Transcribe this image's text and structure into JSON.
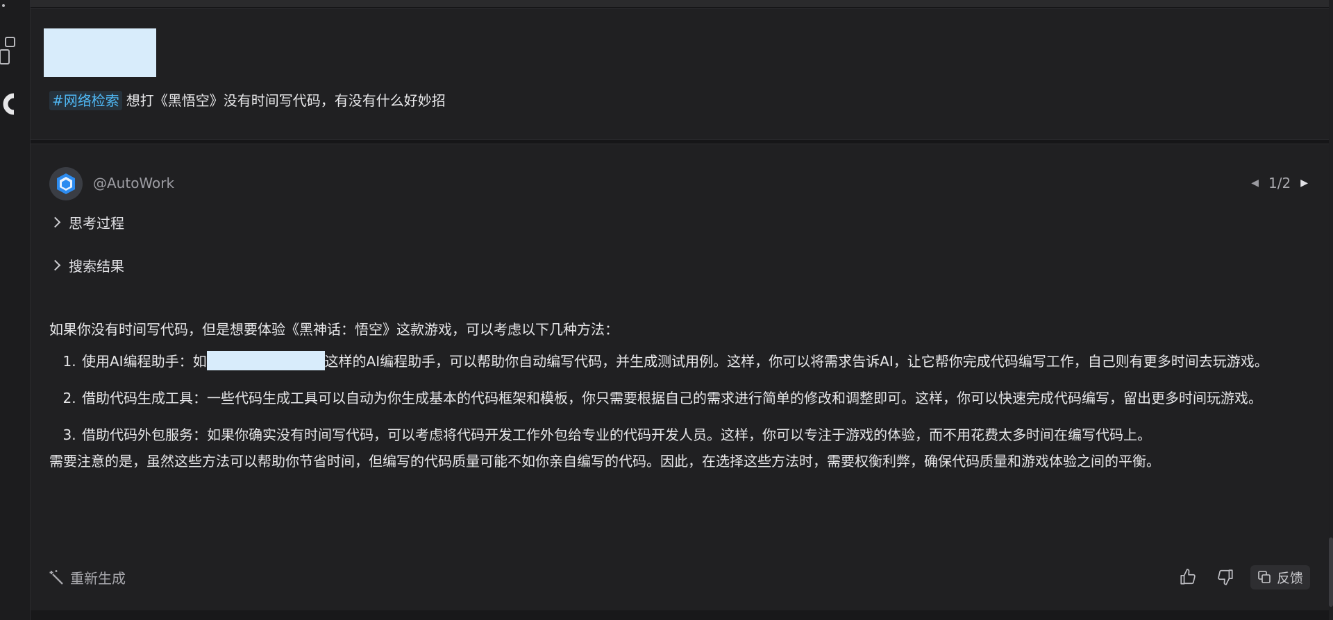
{
  "user_message": {
    "tag": "#网络检索",
    "text": "想打《黑悟空》没有时间写代码，有没有什么好妙招"
  },
  "bot": {
    "name": "@AutoWork",
    "pager": "1/2",
    "sections": {
      "thinking": "思考过程",
      "search_results": "搜索结果"
    },
    "answer": {
      "intro": "如果你没有时间写代码，但是想要体验《黑神话：悟空》这款游戏，可以考虑以下几种方法：",
      "items": [
        {
          "prefix": "使用AI编程助手：如",
          "suffix": "这样的AI编程助手，可以帮助你自动编写代码，并生成测试用例。这样，你可以将需求告诉AI，让它帮你完成代码编写工作，自己则有更多时间去玩游戏。"
        },
        {
          "text": "借助代码生成工具：一些代码生成工具可以自动为你生成基本的代码框架和模板，你只需要根据自己的需求进行简单的修改和调整即可。这样，你可以快速完成代码编写，留出更多时间玩游戏。"
        },
        {
          "text": "借助代码外包服务：如果你确实没有时间写代码，可以考虑将代码开发工作外包给专业的代码开发人员。这样，你可以专注于游戏的体验，而不用花费太多时间在编写代码上。"
        }
      ],
      "conclusion": "需要注意的是，虽然这些方法可以帮助你节省时间，但编写的代码质量可能不如你亲自编写的代码。因此，在选择这些方法时，需要权衡利弊，确保代码质量和游戏体验之间的平衡。"
    },
    "actions": {
      "regenerate": "重新生成",
      "feedback": "反馈"
    }
  },
  "colors": {
    "tag_text": "#4fb7f3",
    "redaction": "#d8ecfb",
    "bot_logo": "#2d8cf0"
  },
  "icons": {
    "regenerate": "magic-wand-icon",
    "like": "thumbs-up-icon",
    "dislike": "thumbs-down-icon",
    "feedback": "copy-icon"
  }
}
